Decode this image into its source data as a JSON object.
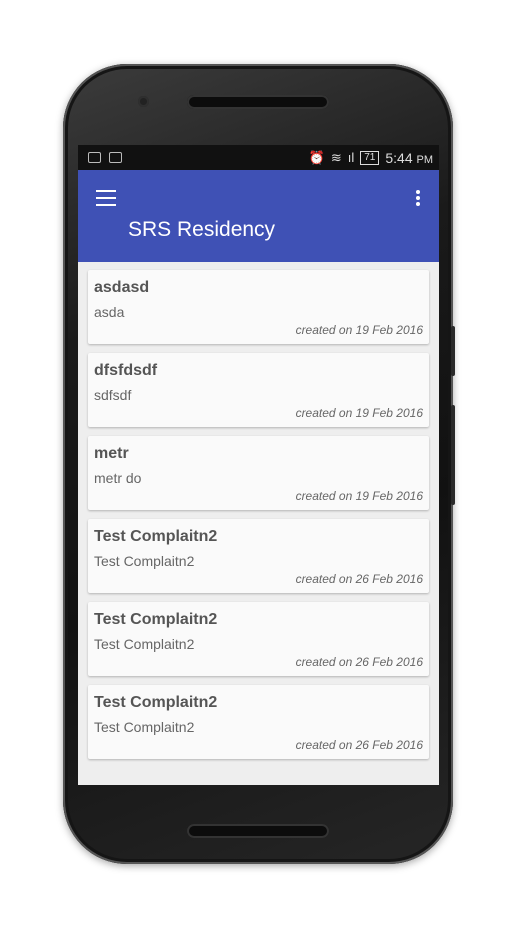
{
  "status_bar": {
    "battery": "71",
    "time": "5:44",
    "ampm": "PM"
  },
  "appbar": {
    "title": "SRS Residency"
  },
  "complaints": [
    {
      "title": "asdasd",
      "body": "asda",
      "date": "created on 19 Feb 2016"
    },
    {
      "title": "dfsfdsdf",
      "body": "sdfsdf",
      "date": "created on 19 Feb 2016"
    },
    {
      "title": "metr",
      "body": "metr do",
      "date": "created on 19 Feb 2016"
    },
    {
      "title": "Test Complaitn2",
      "body": "Test Complaitn2",
      "date": "created on 26 Feb 2016"
    },
    {
      "title": "Test Complaitn2",
      "body": "Test Complaitn2",
      "date": "created on 26 Feb 2016"
    },
    {
      "title": "Test Complaitn2",
      "body": "Test Complaitn2",
      "date": "created on 26 Feb 2016"
    }
  ],
  "colors": {
    "primary": "#3f51b5",
    "card": "#fafafa",
    "background": "#eeeeee"
  }
}
